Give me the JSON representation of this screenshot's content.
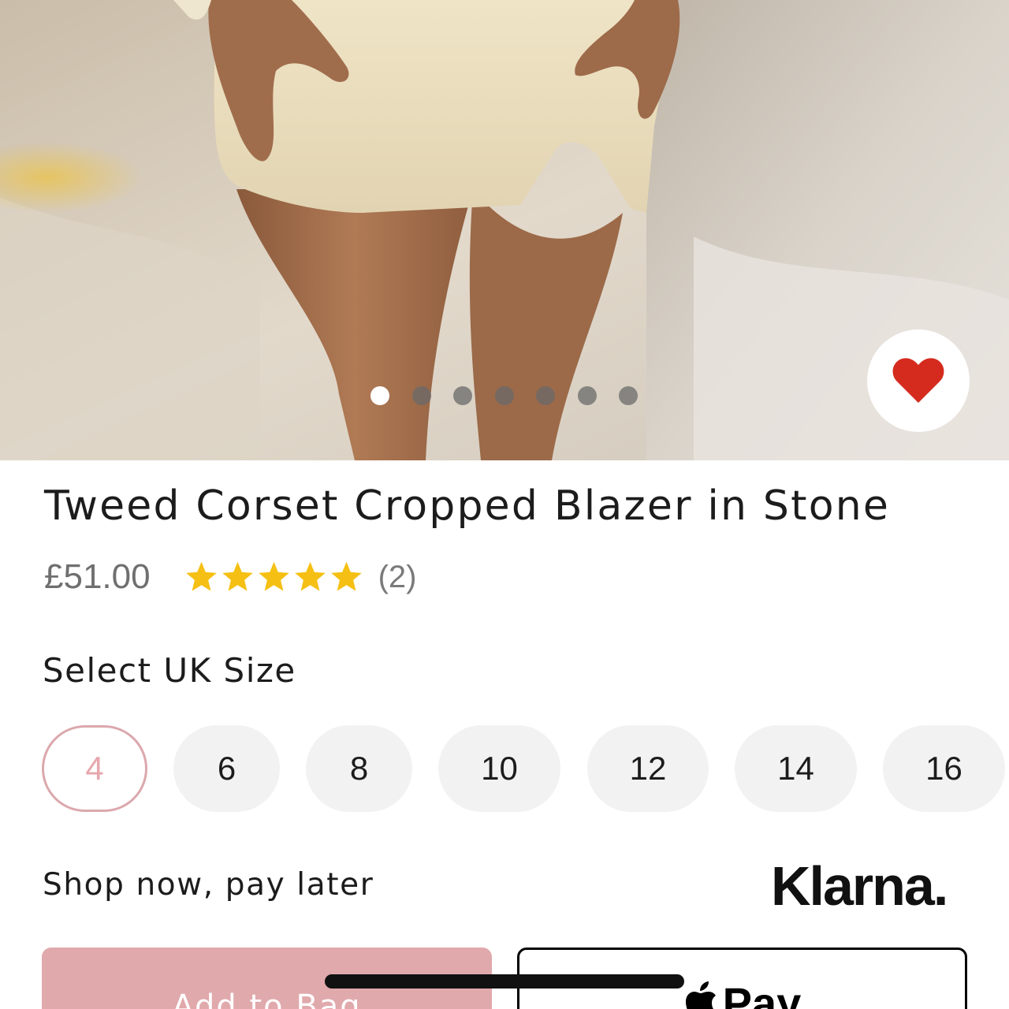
{
  "product": {
    "title": "Tweed Corset Cropped Blazer in Stone",
    "price": "£51.00",
    "rating": {
      "stars": 5,
      "max_stars": 5,
      "review_count": "(2)"
    },
    "gallery": {
      "image_count": 7,
      "active_index": 0
    },
    "favorite_icon": "heart-icon",
    "favorited": true
  },
  "size_selector": {
    "heading": "Select UK Size",
    "sizes": [
      "4",
      "6",
      "8",
      "10",
      "12",
      "14",
      "16"
    ],
    "selected_index": 0
  },
  "pay_later": {
    "text": "Shop now, pay later",
    "brand": "Klarna."
  },
  "actions": {
    "add_to_bag": "Add to Bag",
    "apple_pay": "Pay",
    "apple_pay_icon": "apple-icon"
  },
  "colors": {
    "accent": "#e0a9ac",
    "star": "#f5c013",
    "heart": "#d52b1e"
  }
}
